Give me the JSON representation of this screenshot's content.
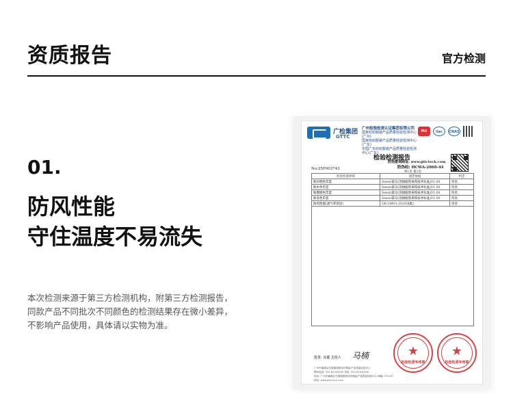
{
  "header": {
    "title": "资质报告",
    "tag": "官方检测"
  },
  "section": {
    "number": "01.",
    "headline_line1": "防风性能",
    "headline_line2": "守住温度不易流失",
    "description_line1": "本次检测来源于第三方检测机构，附第三方检测报告，",
    "description_line2": "同款产品不同批次不同颜色的检测结果存在微小差异，",
    "description_line3": "不影响产品使用，具体请以实物为准。"
  },
  "report": {
    "org_cn": "广检集团",
    "org_en": "GTTC",
    "company_name": "广州检验检测认证集团有限公司",
    "company_sub1": "国家纺织服装产品质量检验检测中心(广州)",
    "company_sub2": "国家纺织服装产品质量检验检测中心(广东)",
    "company_sub3": "中国广东纺织服装产品质量检验检测中心(广东)",
    "cert_ma": "MA",
    "cert_ilac": "ilac",
    "cert_cnas": "CNAS",
    "title": "检验检测报告",
    "query_site": "防伪查询网址: www.gttctech.com",
    "anti_fake_code": "防伪码: HCWA-2060-44",
    "page_info": "共1页 第1页",
    "report_no": "No:25F003743",
    "table": {
      "headers": [
        "检验检测项目",
        "测定依据",
        "判定"
      ],
      "rows": [
        [
          "耐日晒色牢度",
          "Sensir森马(羽绒服装采购技术标准)V1.00",
          "符合"
        ],
        [
          "耐水色牢度",
          "Sensir森马(羽绒服装采购技术标准)V1.00",
          "符合"
        ],
        [
          "耐摩擦色牢度",
          "Sensir森马(羽绒服装采购技术标准)V1.00",
          "符合"
        ],
        [
          "耐洗色牢度",
          "Sensir森马(羽绒服装采购技术标准)V1.00",
          "符合"
        ],
        [
          "防风性能(透气率测试)",
          "GB 18401-2010(B类)",
          "符合"
        ]
      ]
    },
    "sign_label": "签发: 马健  主检人",
    "signature": "马楠",
    "footer_line1": "广州市番禺区石楼镇国家纺织服装产品质量检验中心",
    "footer_line2": "联系电话: 020-82040830  传真: 020-82040830",
    "footer_line3": "地址: 广州市番禺区石楼镇国家纺织服装产品质量检验中心  邮编: 511447",
    "footer_line4": "网址: www.gttctech.com",
    "seal_text": "检验检测专用章",
    "seal_text_2": "检验检测专用章",
    "seal_color": "#d42020",
    "brand_blue": "#1f6fb5"
  }
}
